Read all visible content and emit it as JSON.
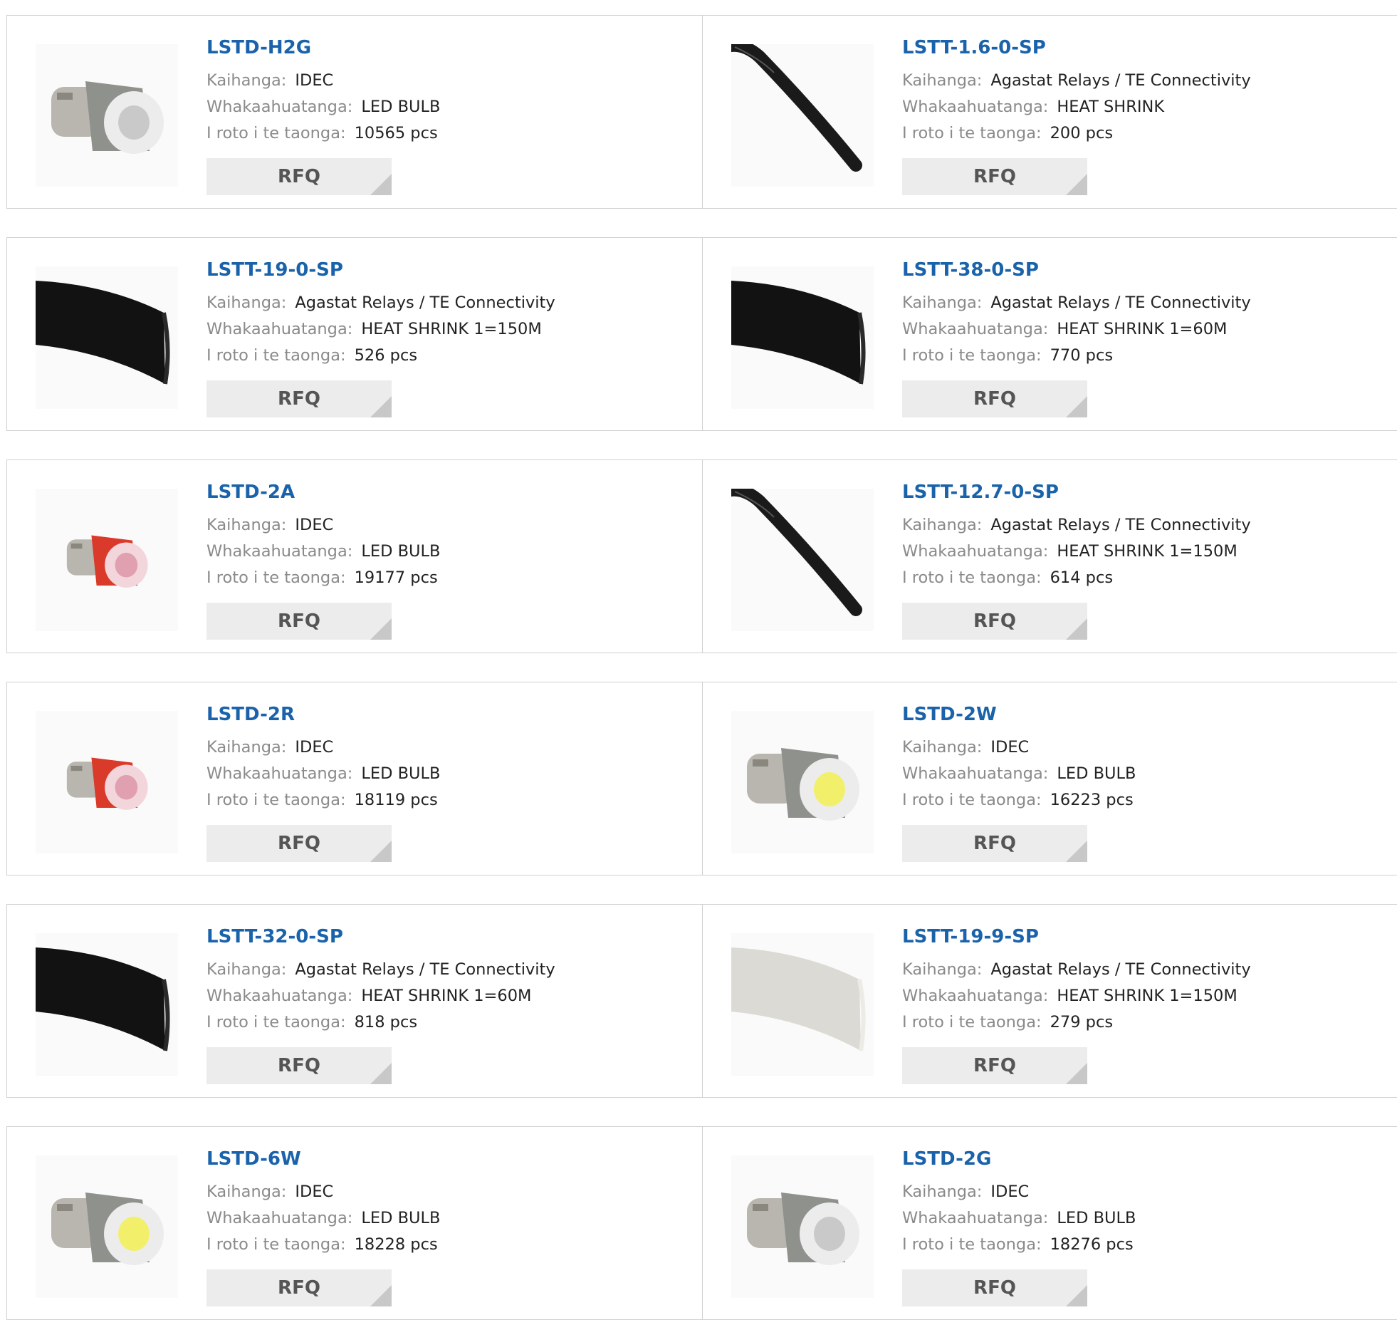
{
  "labels": {
    "manufacturer": "Kaihanga:",
    "description": "Whakaahuatanga:",
    "stock": "I roto i te taonga:",
    "rfq": "RFQ"
  },
  "products": [
    {
      "part": "LSTD-H2G",
      "manufacturer": "IDEC",
      "description": "LED BULB",
      "stock": "10565 pcs",
      "image": "bulb-gray"
    },
    {
      "part": "LSTT-1.6-0-SP",
      "manufacturer": "Agastat Relays / TE Connectivity",
      "description": "HEAT SHRINK",
      "stock": "200 pcs",
      "image": "tube-thin-black"
    },
    {
      "part": "LSTT-19-0-SP",
      "manufacturer": "Agastat Relays / TE Connectivity",
      "description": "HEAT SHRINK 1=150M",
      "stock": "526 pcs",
      "image": "tube-wide-black"
    },
    {
      "part": "LSTT-38-0-SP",
      "manufacturer": "Agastat Relays / TE Connectivity",
      "description": "HEAT SHRINK 1=60M",
      "stock": "770 pcs",
      "image": "tube-wide-black"
    },
    {
      "part": "LSTD-2A",
      "manufacturer": "IDEC",
      "description": "LED BULB",
      "stock": "19177 pcs",
      "image": "bulb-red"
    },
    {
      "part": "LSTT-12.7-0-SP",
      "manufacturer": "Agastat Relays / TE Connectivity",
      "description": "HEAT SHRINK 1=150M",
      "stock": "614 pcs",
      "image": "tube-thin-black"
    },
    {
      "part": "LSTD-2R",
      "manufacturer": "IDEC",
      "description": "LED BULB",
      "stock": "18119 pcs",
      "image": "bulb-red"
    },
    {
      "part": "LSTD-2W",
      "manufacturer": "IDEC",
      "description": "LED BULB",
      "stock": "16223 pcs",
      "image": "bulb-gray-yellow"
    },
    {
      "part": "LSTT-32-0-SP",
      "manufacturer": "Agastat Relays / TE Connectivity",
      "description": "HEAT SHRINK 1=60M",
      "stock": "818 pcs",
      "image": "tube-wide-black"
    },
    {
      "part": "LSTT-19-9-SP",
      "manufacturer": "Agastat Relays / TE Connectivity",
      "description": "HEAT SHRINK 1=150M",
      "stock": "279 pcs",
      "image": "tube-wide-white"
    },
    {
      "part": "LSTD-6W",
      "manufacturer": "IDEC",
      "description": "LED BULB",
      "stock": "18228 pcs",
      "image": "bulb-gray-yellow"
    },
    {
      "part": "LSTD-2G",
      "manufacturer": "IDEC",
      "description": "LED BULB",
      "stock": "18276 pcs",
      "image": "bulb-gray"
    }
  ]
}
